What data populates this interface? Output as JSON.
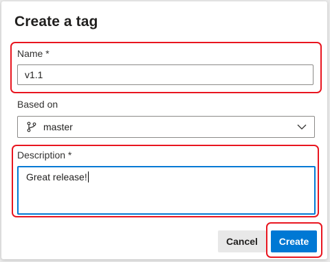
{
  "dialog": {
    "title": "Create a tag"
  },
  "name_field": {
    "label": "Name *",
    "value": "v1.1"
  },
  "based_on": {
    "label": "Based on",
    "selected": "master",
    "icon": "branch-icon"
  },
  "description_field": {
    "label": "Description *",
    "value": "Great release!"
  },
  "buttons": {
    "cancel_label": "Cancel",
    "create_label": "Create"
  },
  "colors": {
    "accent": "#0078d4",
    "highlight": "#e8141e"
  }
}
